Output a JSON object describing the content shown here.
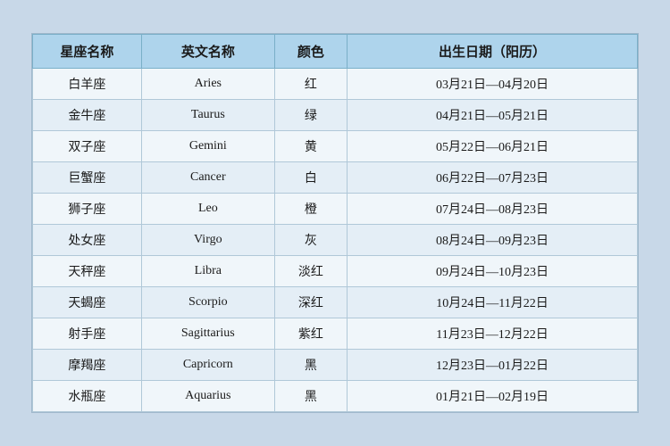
{
  "table": {
    "headers": [
      "星座名称",
      "英文名称",
      "颜色",
      "出生日期（阳历）"
    ],
    "rows": [
      {
        "zh": "白羊座",
        "en": "Aries",
        "color": "红",
        "date": "03月21日—04月20日"
      },
      {
        "zh": "金牛座",
        "en": "Taurus",
        "color": "绿",
        "date": "04月21日—05月21日"
      },
      {
        "zh": "双子座",
        "en": "Gemini",
        "color": "黄",
        "date": "05月22日—06月21日"
      },
      {
        "zh": "巨蟹座",
        "en": "Cancer",
        "color": "白",
        "date": "06月22日—07月23日"
      },
      {
        "zh": "狮子座",
        "en": "Leo",
        "color": "橙",
        "date": "07月24日—08月23日"
      },
      {
        "zh": "处女座",
        "en": "Virgo",
        "color": "灰",
        "date": "08月24日—09月23日"
      },
      {
        "zh": "天秤座",
        "en": "Libra",
        "color": "淡红",
        "date": "09月24日—10月23日"
      },
      {
        "zh": "天蝎座",
        "en": "Scorpio",
        "color": "深红",
        "date": "10月24日—11月22日"
      },
      {
        "zh": "射手座",
        "en": "Sagittarius",
        "color": "紫红",
        "date": "11月23日—12月22日"
      },
      {
        "zh": "摩羯座",
        "en": "Capricorn",
        "color": "黑",
        "date": "12月23日—01月22日"
      },
      {
        "zh": "水瓶座",
        "en": "Aquarius",
        "color": "黑",
        "date": "01月21日—02月19日"
      }
    ]
  }
}
